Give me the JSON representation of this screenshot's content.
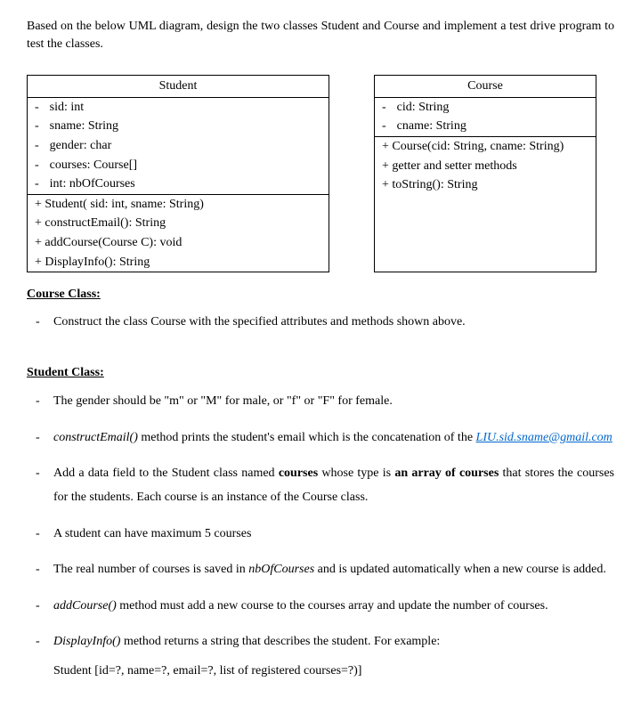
{
  "intro": "Based on the below UML diagram, design the two classes Student and Course and implement a test drive program to test the classes.",
  "uml": {
    "student": {
      "title": "Student",
      "attrs": [
        "sid: int",
        "sname: String",
        "gender: char",
        "courses: Course[]",
        "int: nbOfCourses"
      ],
      "methods": [
        "+ Student( sid: int, sname: String)",
        "+ constructEmail(): String",
        "+ addCourse(Course C): void",
        "+ DisplayInfo(): String"
      ]
    },
    "course": {
      "title": "Course",
      "attrs": [
        "cid: String",
        "cname: String"
      ],
      "methods": [
        "+ Course(cid: String, cname: String)",
        "+ getter and setter methods",
        "+ toString(): String"
      ]
    }
  },
  "courseClass": {
    "heading": "Course Class:",
    "items": [
      "Construct the class Course with the specified attributes and methods shown above."
    ]
  },
  "studentClass": {
    "heading": "Student Class:",
    "item1_pre": "The gender should be \"m\" or \"M\" for male, or \"f\" or \"F\" for female.",
    "item2_pre": "constructEmail()",
    "item2_post": "  method prints the student's email which is the concatenation of the ",
    "item2_email": "LIU.sid.sname@gmail.com",
    "item3_pre": "Add a data field to the Student class named ",
    "item3_b1": "courses",
    "item3_mid": " whose type is ",
    "item3_b2": "an array of courses",
    "item3_post": " that stores the courses for the students. Each course is an instance of the Course class.",
    "item4": "A student can have maximum 5 courses",
    "item5_pre": "The real number of courses is saved in ",
    "item5_i": "nbOfCourses",
    "item5_post": " and is updated automatically when a new course is added.",
    "item6_i": "addCourse()",
    "item6_post": " method must add a new course to the courses array and update the number of courses.",
    "item7_i": "DisplayInfo()",
    "item7_post": " method returns a string that describes the student. For example:",
    "item7_example": "Student [id=?, name=?, email=?, list of registered courses=?)]"
  }
}
